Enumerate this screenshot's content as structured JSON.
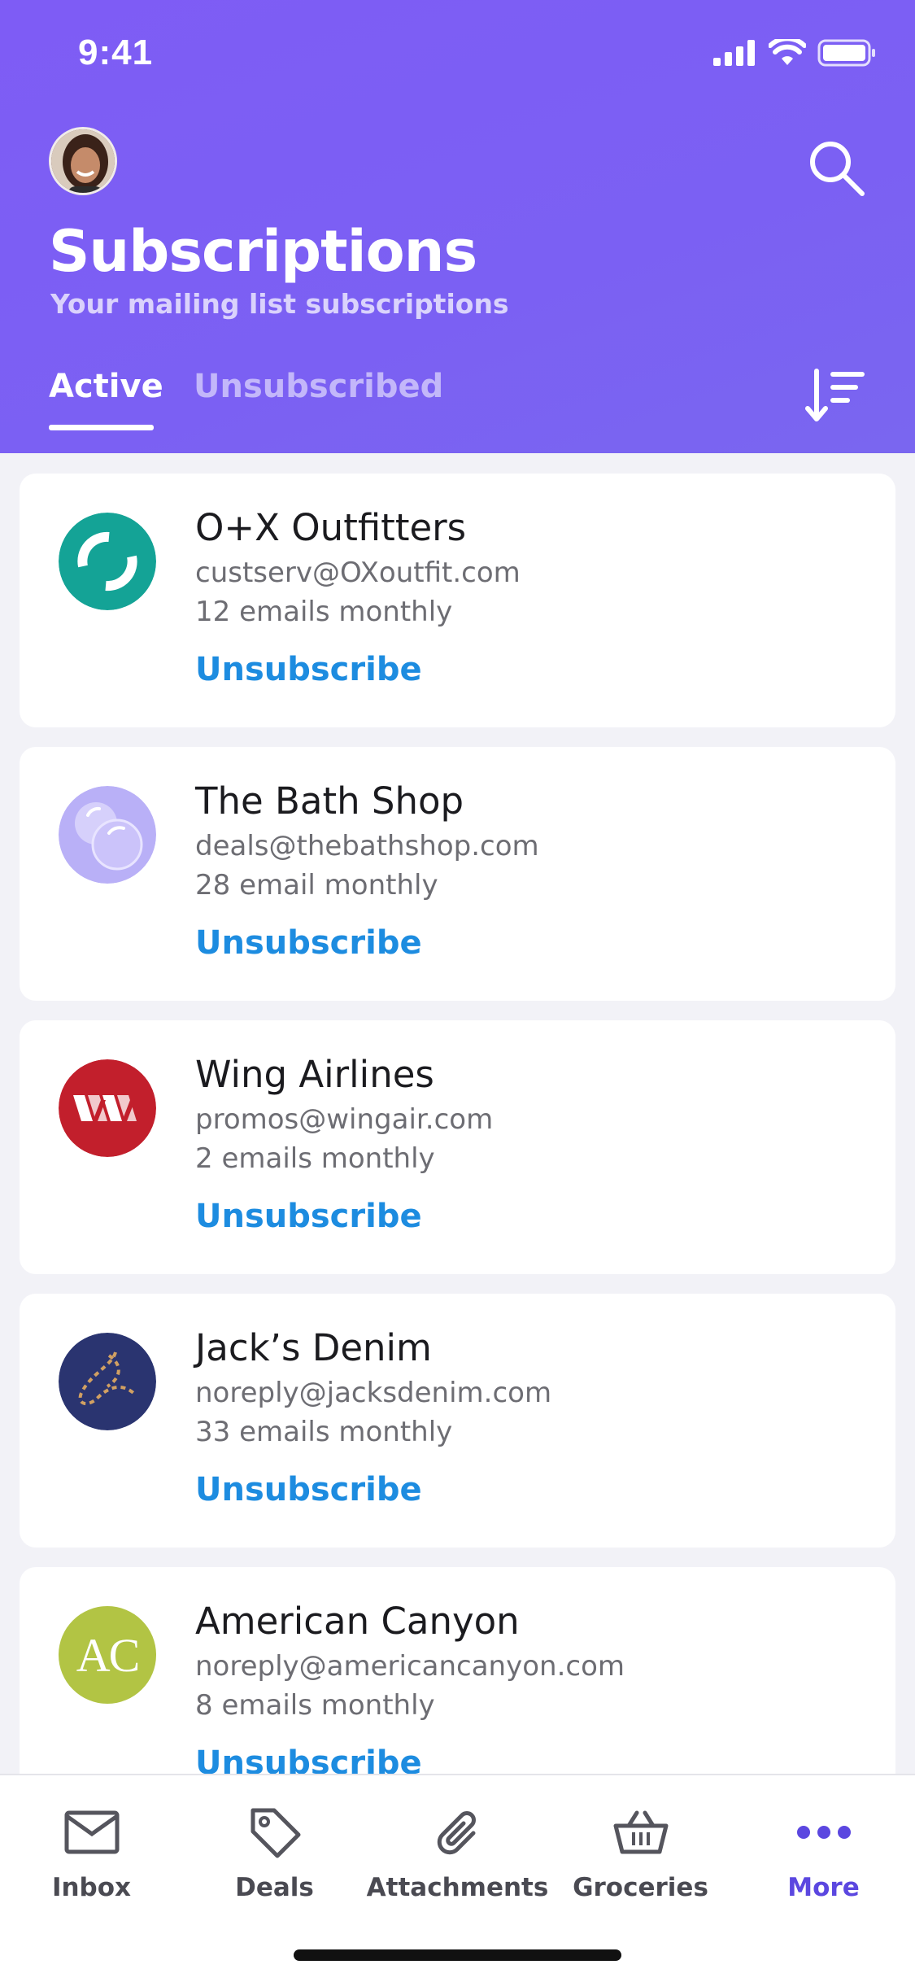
{
  "status_bar": {
    "time": "9:41"
  },
  "header": {
    "title": "Subscriptions",
    "subtitle": "Your mailing list subscriptions",
    "tabs": [
      {
        "label": "Active",
        "selected": true
      },
      {
        "label": "Unsubscribed",
        "selected": false
      }
    ],
    "icons": [
      "avatar",
      "search-icon",
      "sort-icon"
    ]
  },
  "subscriptions": [
    {
      "name": "O+X Outfitters",
      "email": "custserv@OXoutfit.com",
      "frequency": "12 emails monthly",
      "action": "Unsubscribe",
      "logo": "teal-ring-logo",
      "logo_color": "#14a396"
    },
    {
      "name": "The Bath Shop",
      "email": "deals@thebathshop.com",
      "frequency": "28 email monthly",
      "action": "Unsubscribe",
      "logo": "bubbles-logo",
      "logo_color": "#b9b0f7"
    },
    {
      "name": "Wing Airlines",
      "email": "promos@wingair.com",
      "frequency": "2 emails monthly",
      "action": "Unsubscribe",
      "logo": "wa-logo",
      "logo_color": "#c21f2c"
    },
    {
      "name": "Jack’s Denim",
      "email": "noreply@jacksdenim.com",
      "frequency": "33 emails monthly",
      "action": "Unsubscribe",
      "logo": "denim-logo",
      "logo_color": "#2a3470"
    },
    {
      "name": "American Canyon",
      "email": "noreply@americancanyon.com",
      "frequency": "8 emails monthly",
      "action": "Unsubscribe",
      "logo": "ac-logo",
      "logo_color": "#b2c444",
      "logo_text": "AC"
    }
  ],
  "tab_bar": {
    "items": [
      {
        "label": "Inbox",
        "icon": "envelope-icon"
      },
      {
        "label": "Deals",
        "icon": "tag-icon"
      },
      {
        "label": "Attachments",
        "icon": "paperclip-icon"
      },
      {
        "label": "Groceries",
        "icon": "basket-icon"
      },
      {
        "label": "More",
        "icon": "more-icon",
        "selected": true
      }
    ]
  },
  "colors": {
    "header": "#7b5ff4",
    "accent_link": "#1d8ce0",
    "active_tab": "#5b47e0"
  }
}
